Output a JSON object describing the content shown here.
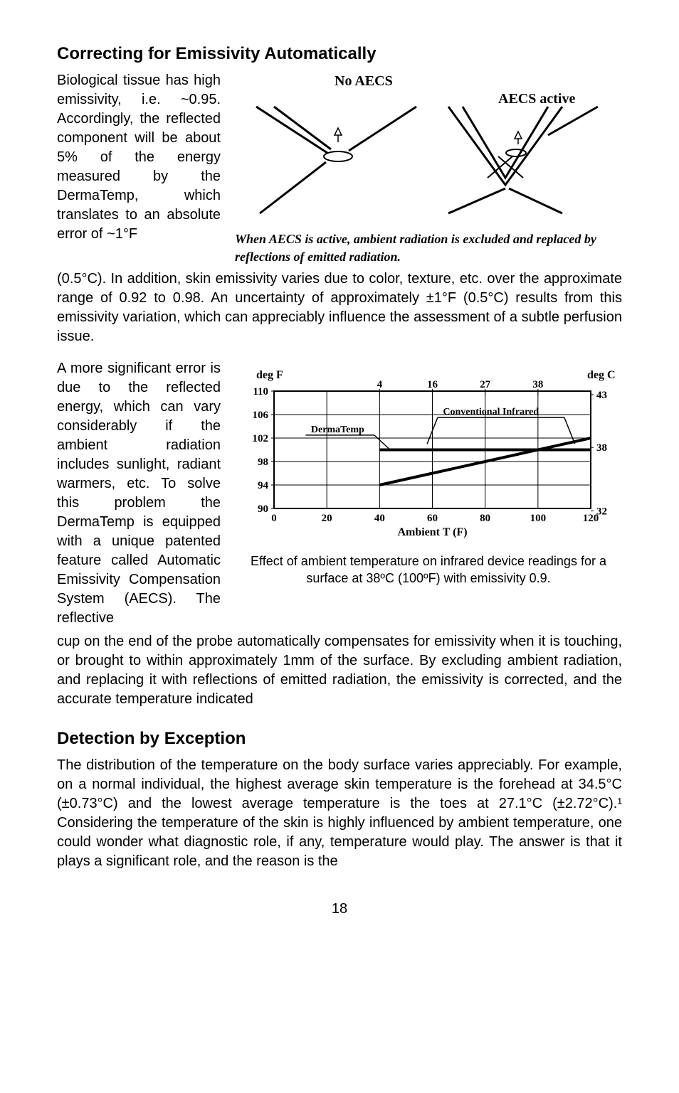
{
  "section1": {
    "heading": "Correcting for Emissivity Automatically",
    "left1": "Biological tissue has high emissivity, i.e. ~0.95. Accordingly, the reflected component will be about 5% of the energy measured by the DermaTemp, which translates to an absolute error of ~1°F",
    "fig1": {
      "label_no_aecs": "No AECS",
      "label_aecs_active": "AECS active",
      "caption": "When AECS is active, ambient radiation is excluded and replaced by reflections of emitted radiation."
    },
    "para_after_fig1": "(0.5°C). In addition, skin emissivity varies due to color, texture, etc. over the approximate  range of 0.92 to 0.98. An uncertainty of approximately ±1°F (0.5°C) results from this emissivity variation, which can appreciably influence the assessment of a subtle perfusion issue.",
    "left2": "A  more significant error is due to the reflected energy, which can vary considerably if the ambient radiation includes sunlight, radiant warmers, etc. To solve this problem the DermaTemp is equipped with a unique patented feature called Automatic Emissivity Compensation System (AECS). The reflective",
    "chart_caption": "Effect of ambient temperature on infrared device readings for a surface at 38ºC (100ºF) with emissivity 0.9.",
    "para_after_chart": "cup on the end of the probe automatically compensates for emissivity when it is touching, or brought to within approximately 1mm of the surface. By excluding ambient radiation, and replacing it with reflections of emitted radiation, the emissivity is corrected, and the accurate temperature indicated"
  },
  "section2": {
    "heading": "Detection by Exception",
    "para": "The distribution of the temperature on the body surface varies appreciably. For example, on a normal individual, the highest average skin temperature is the forehead at 34.5°C (±0.73°C) and the lowest average temperature is the toes at 27.1°C (±2.72°C).¹    Considering the temperature of the skin is highly influenced by ambient temperature, one could wonder what diagnostic role, if any, temperature would play. The answer is that it plays a significant role, and the reason is the"
  },
  "page_number": "18",
  "chart_data": {
    "type": "line",
    "title": "",
    "xlabel": "Ambient T (F)",
    "ylabel_left": "deg F",
    "ylabel_right": "deg C",
    "x_ticks": [
      0,
      20,
      40,
      60,
      80,
      100,
      120
    ],
    "y_ticks_left": [
      90,
      94,
      98,
      102,
      106,
      110
    ],
    "y_ticks_right": [
      32,
      38,
      43
    ],
    "top_labels": [
      4,
      16,
      27,
      38
    ],
    "series": [
      {
        "name": "DermaTemp",
        "x": [
          40,
          120
        ],
        "y": [
          100,
          100
        ]
      },
      {
        "name": "Conventional Infrared",
        "x": [
          40,
          60,
          80,
          100,
          120
        ],
        "y": [
          94,
          96,
          98,
          100,
          102
        ]
      }
    ],
    "xlim": [
      0,
      120
    ],
    "ylim": [
      90,
      110
    ]
  }
}
